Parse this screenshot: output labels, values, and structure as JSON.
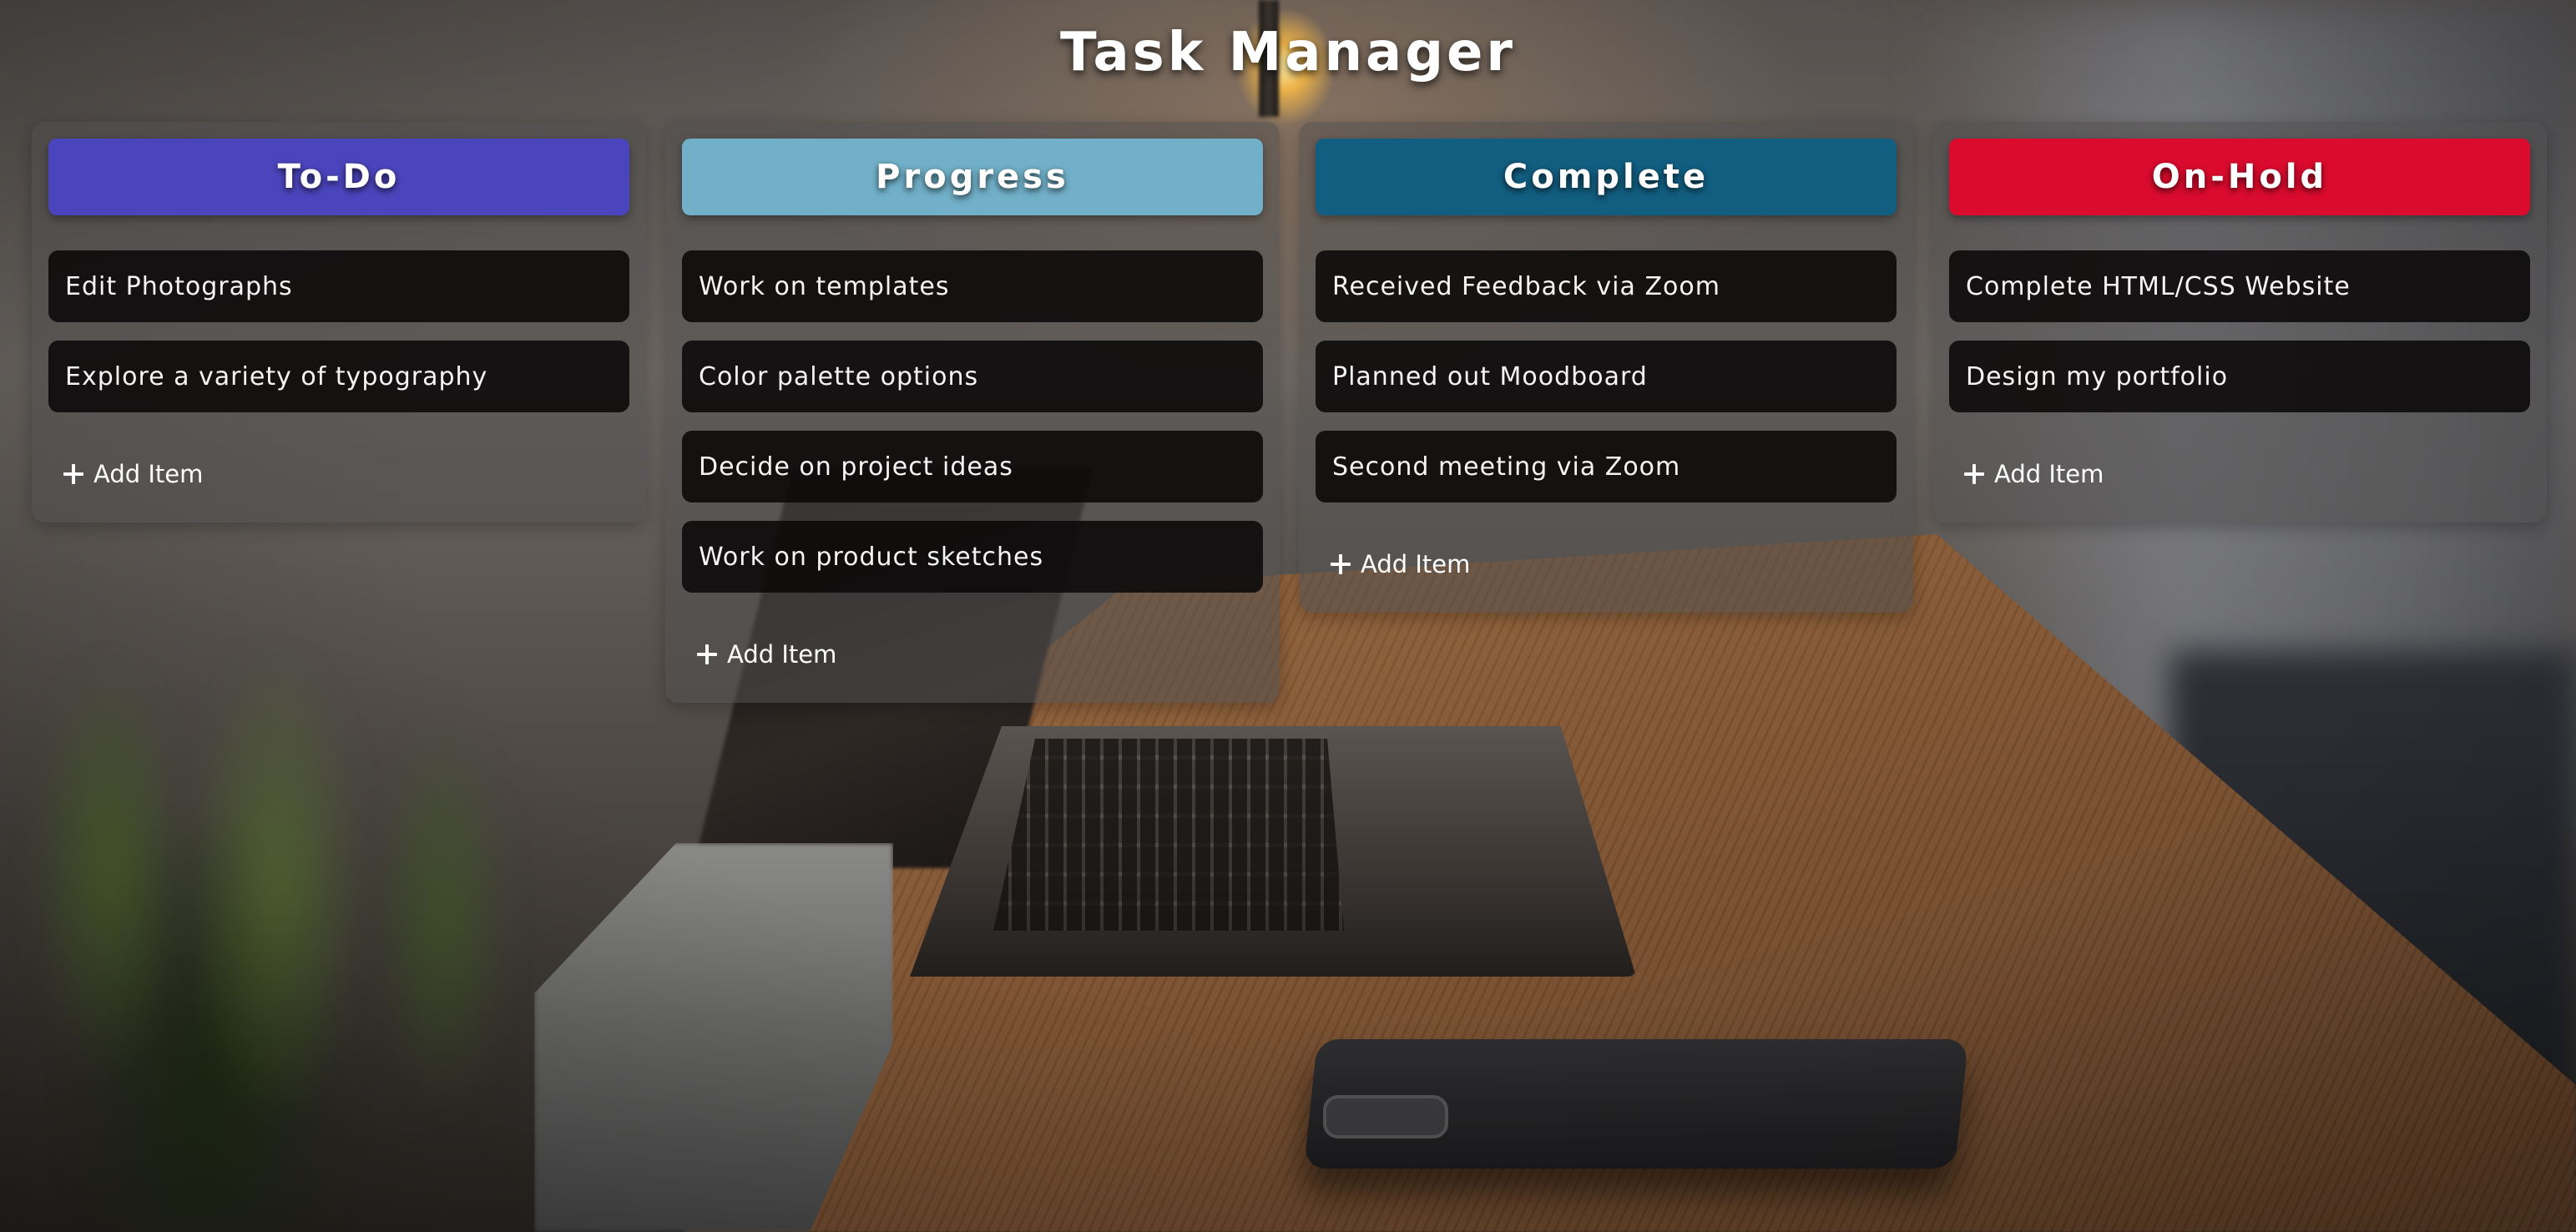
{
  "app": {
    "title": "Task Manager"
  },
  "colors": {
    "todo": "#4b45bd",
    "progress": "#71b0c8",
    "complete": "#125e80",
    "onhold": "#db0b2e",
    "card": "#0a0808",
    "column_bg": "#504e4e"
  },
  "icons": {
    "add": "plus-icon"
  },
  "columns": [
    {
      "title": "To-Do",
      "items": [
        "Edit Photographs",
        "Explore a variety of typography"
      ],
      "add_label": "Add Item"
    },
    {
      "title": "Progress",
      "items": [
        "Work on templates",
        "Color palette options",
        "Decide on project ideas",
        "Work on product sketches"
      ],
      "add_label": "Add Item"
    },
    {
      "title": "Complete",
      "items": [
        "Received Feedback via Zoom",
        "Planned out Moodboard",
        "Second meeting via Zoom"
      ],
      "add_label": "Add Item"
    },
    {
      "title": "On-Hold",
      "items": [
        "Complete HTML/CSS Website",
        "Design my portfolio"
      ],
      "add_label": "Add Item"
    }
  ]
}
